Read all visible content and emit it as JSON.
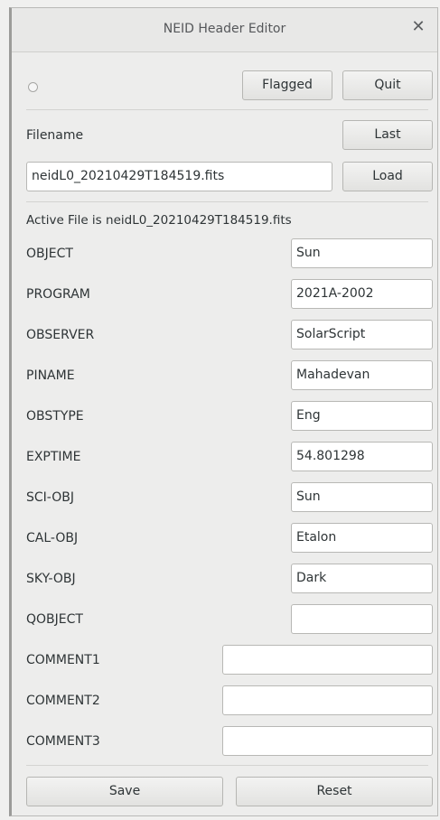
{
  "window": {
    "title": "NEID Header Editor"
  },
  "toolbar": {
    "flagged_label": "Flagged",
    "quit_label": "Quit"
  },
  "file": {
    "filename_label": "Filename",
    "last_label": "Last",
    "filename_value": "neidL0_20210429T184519.fits",
    "load_label": "Load",
    "active_text": "Active File is neidL0_20210429T184519.fits"
  },
  "fields": {
    "object": {
      "label": "OBJECT",
      "value": "Sun"
    },
    "program": {
      "label": "PROGRAM",
      "value": "2021A-2002"
    },
    "observer": {
      "label": "OBSERVER",
      "value": "SolarScript"
    },
    "piname": {
      "label": "PINAME",
      "value": "Mahadevan"
    },
    "obstype": {
      "label": "OBSTYPE",
      "value": "Eng"
    },
    "exptime": {
      "label": "EXPTIME",
      "value": "54.801298"
    },
    "sciobj": {
      "label": "SCI-OBJ",
      "value": "Sun"
    },
    "calobj": {
      "label": "CAL-OBJ",
      "value": "Etalon"
    },
    "skyobj": {
      "label": "SKY-OBJ",
      "value": "Dark"
    },
    "qobject": {
      "label": "QOBJECT",
      "value": ""
    },
    "comment1": {
      "label": "COMMENT1",
      "value": ""
    },
    "comment2": {
      "label": "COMMENT2",
      "value": ""
    },
    "comment3": {
      "label": "COMMENT3",
      "value": ""
    }
  },
  "footer": {
    "save_label": "Save",
    "reset_label": "Reset"
  }
}
